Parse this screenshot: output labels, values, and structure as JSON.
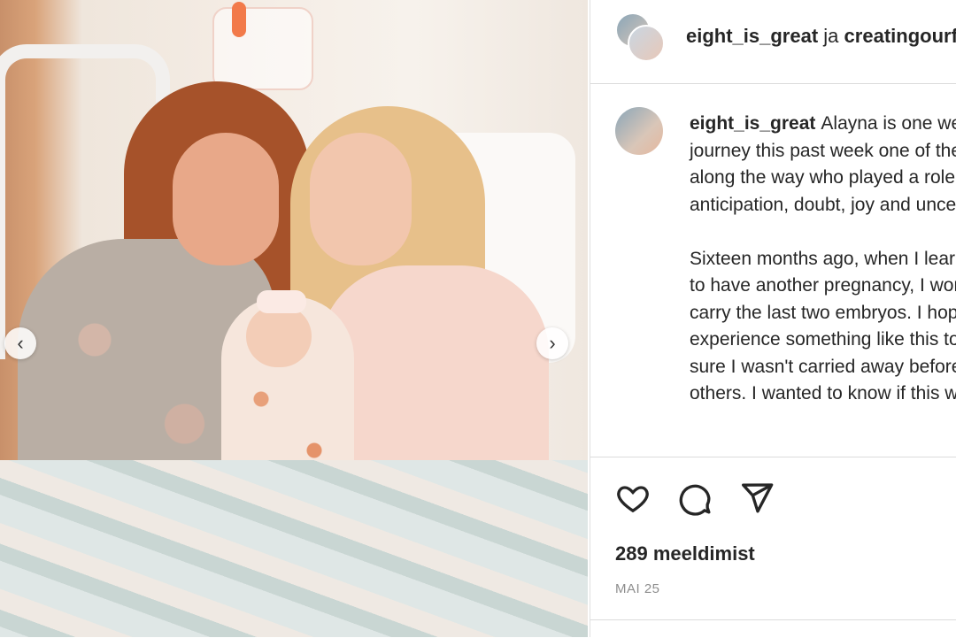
{
  "post": {
    "image_alt": "",
    "carousel": {
      "prev_icon": "chevron-left-icon",
      "next_icon": "chevron-right-icon",
      "prev_glyph": "‹",
      "next_glyph": "›"
    }
  },
  "header": {
    "username": "eight_is_great",
    "connector": "ja",
    "collaborator": "creatingourf"
  },
  "caption": {
    "username": "eight_is_great",
    "paragraph1": "Alayna is one week old! My surrogacy journey this past week one of the things I experienced along the way who played a role in the journey. It was anticipation, doubt, joy and uncertainty",
    "paragraph2": "Sixteen months ago, when I learned I wouldn't be able to have another pregnancy, I wondered who should carry the last two embryos. I hoped my friend would experience something like this too. I needed to make sure I wasn't carried away before I shared the idea with others. I wanted to know if this was the right choice"
  },
  "actions": {
    "like_icon": "heart-icon",
    "comment_icon": "comment-icon",
    "share_icon": "send-icon"
  },
  "likes_text": "289 meeldimist",
  "date_text": "MAI 25"
}
